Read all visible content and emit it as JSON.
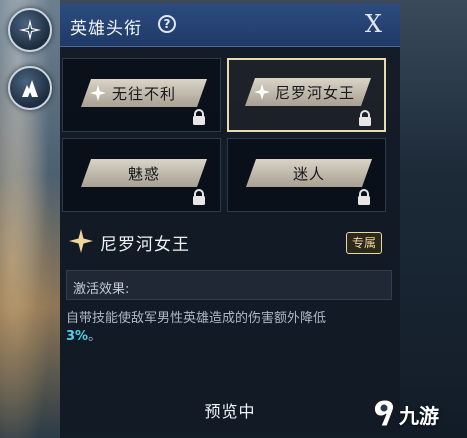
{
  "header": {
    "title": "英雄头衔",
    "help_symbol": "?",
    "close_label": "X"
  },
  "titles": [
    {
      "label": "无往不利",
      "locked": true,
      "selected": false,
      "has_star": true
    },
    {
      "label": "尼罗河女王",
      "locked": true,
      "selected": true,
      "has_star": true
    },
    {
      "label": "魅惑",
      "locked": true,
      "selected": false,
      "has_star": false
    },
    {
      "label": "迷人",
      "locked": true,
      "selected": false,
      "has_star": false
    }
  ],
  "detail": {
    "title": "尼罗河女王",
    "badge": "专属",
    "effect_label": "激活效果:",
    "description": "自带技能使敌军男性英雄造成的伤害额外降低",
    "value": "3%",
    "value_suffix": "。"
  },
  "footer": {
    "preview": "预览中"
  },
  "watermark": {
    "text": "九游"
  },
  "colors": {
    "header_bg": "#2c4c80",
    "selected_border": "#e9dbb1",
    "accent_gold": "#f0d69a",
    "value_cyan": "#4fd0e5"
  }
}
